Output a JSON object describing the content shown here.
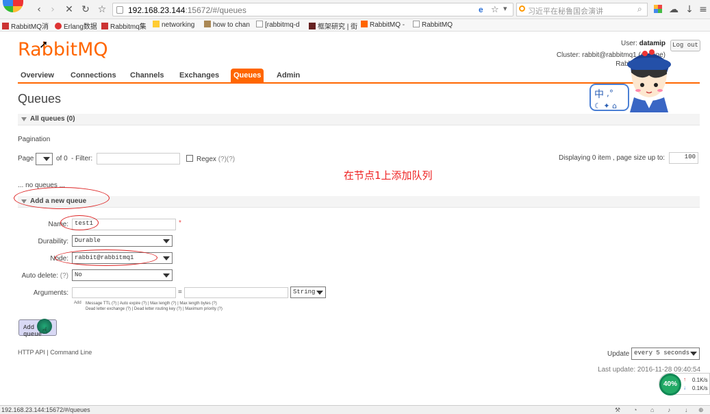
{
  "browser": {
    "url_host": "192.168.23.144",
    "url_rest": ":15672/#/queues",
    "search_placeholder": "习近平在秘鲁国会演讲",
    "bookmarks": [
      "RabbitMQ消",
      "Erlang数据",
      "Rabbitmq集",
      "networking",
      "how to chan",
      "[rabbitmq-d",
      "框架研究 | 街",
      "RabbitMQ -",
      "RabbitMQ"
    ],
    "status_url": "192.168.23.144:15672/#/queues"
  },
  "header": {
    "logo_rabbit": "RabbitMQ",
    "user_label": "User:",
    "user": "datamip",
    "cluster_label": "Cluster:",
    "cluster": "rabbit@rabbitmq1",
    "cluster_change": "(change)",
    "version": "RabbitMQ 3.6.5,",
    "logout": "Log out"
  },
  "tabs": [
    "Overview",
    "Connections",
    "Channels",
    "Exchanges",
    "Queues",
    "Admin"
  ],
  "active_tab": "Queues",
  "page_title": "Queues",
  "all_queues": {
    "label": "All queues (0)",
    "pagination_label": "Pagination",
    "page_label": "Page",
    "of_label": "of 0",
    "filter_label": "- Filter:",
    "regex_label": "Regex",
    "regex_help": "(?)(?)",
    "displaying": "Displaying 0 item , page size up to:",
    "page_size": "100",
    "no_queues": "... no queues ..."
  },
  "annotation": "在节点1上添加队列",
  "add_queue": {
    "section_label": "Add a new queue",
    "name_label": "Name:",
    "name_value": "test1",
    "required_star": "*",
    "durability_label": "Durability:",
    "durability_value": "Durable",
    "node_label": "Node:",
    "node_value": "rabbit@rabbitmq1",
    "auto_delete_label": "Auto delete:",
    "auto_delete_help": "(?)",
    "auto_delete_value": "No",
    "arguments_label": "Arguments:",
    "equals": "=",
    "arg_type": "String",
    "add_hint_label": "Add",
    "arg_hints_line1": "Message TTL (?) | Auto expire (?) | Max length (?) | Max length bytes (?)",
    "arg_hints_line2": "Dead letter exchange (?) | Dead letter routing key (?) | Maximum priority (?)",
    "button": "Add queue"
  },
  "footer": {
    "http_api": "HTTP API",
    "command_line": "Command Line",
    "update_label": "Update",
    "update_value": "every 5 seconds",
    "last_update": "Last update: 2016-11-28 09:40:54"
  },
  "speed": {
    "percent": "40%",
    "up": "0.1K/s",
    "down": "0.1K/s"
  }
}
